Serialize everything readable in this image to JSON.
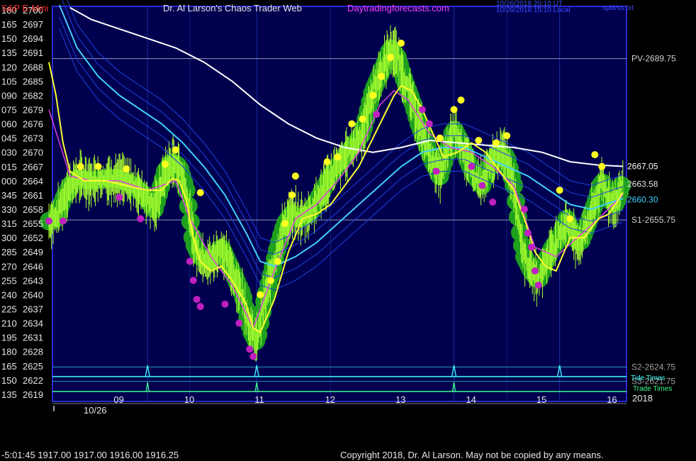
{
  "header": {
    "instrument": "S&P E-Mini",
    "site_title": "Dr. Al Larson's Chaos Trader Web",
    "site_url": "Daytradingforecasts.com",
    "timestamp_utc": "10/26/2018 20:10 UT",
    "timestamp_local": "10/26/2018 15:10 Local",
    "file_label": "split/ss.txt"
  },
  "footer": {
    "status": "-5:01:45  1917.00 1917.00 1916.00 1916.25",
    "copyright": "Copyright 2018, Dr. Al Larson. May not be copied by any means.",
    "year": "2018",
    "date_label": "10/26"
  },
  "colors": {
    "background": "#000000",
    "plot_bg": "#00004e",
    "frame": "#2a2ad0",
    "text": "#e6e6e6",
    "title_red": "#ff3030",
    "url_magenta": "#ff40ff",
    "price": "#a8ff30",
    "glow": "#1fa01f",
    "fast_ma": "#ffff30",
    "mid_ma": "#e040e0",
    "slow_ma": "#40d0ff",
    "slowest_ma": "#ffffff",
    "band": "#2040e0",
    "hi_dot": "#ffff20",
    "lo_dot": "#c020c0",
    "tide": "#40ffff",
    "trade": "#40ff90"
  },
  "chart_data": {
    "type": "line",
    "title": "S&P E-Mini",
    "y_axis": {
      "ylim": [
        2617.5,
        2700.75
      ],
      "price_ticks": [
        2700,
        2697,
        2694,
        2691,
        2688,
        2685,
        2682,
        2679,
        2676,
        2673,
        2670,
        2667,
        2664,
        2661,
        2658,
        2655,
        2652,
        2649,
        2646,
        2643,
        2640,
        2637,
        2634,
        2631,
        2628,
        2625,
        2622,
        2619
      ],
      "angle_ticks": [
        "180",
        "165",
        "150",
        "135",
        "120",
        "105",
        "090",
        "075",
        "060",
        "045",
        "030",
        "015",
        "000",
        "345",
        "330",
        "315",
        "300",
        "285",
        "270",
        "255",
        "240",
        "225",
        "210",
        "195",
        "180",
        "165",
        "150",
        "135"
      ]
    },
    "x_axis": {
      "hours": [
        "09",
        "10",
        "11",
        "12",
        "13",
        "14",
        "15",
        "16"
      ]
    },
    "levels": [
      {
        "name": "PV-2689.75",
        "value": 2689.75
      },
      {
        "name": "S1-2655.75",
        "value": 2655.75
      },
      {
        "name": "S2-2624.75",
        "value": 2624.75
      },
      {
        "name": "S3-2621.75",
        "value": 2621.75
      }
    ],
    "end_labels": [
      {
        "label": "2667.05",
        "value": 2667.05,
        "series": "slowest_ma"
      },
      {
        "label": "2663.58",
        "value": 2663.58,
        "series": "fast_ma"
      },
      {
        "label": "2660.30",
        "value": 2660.3,
        "series": "slow_ma"
      }
    ],
    "lines_legend": [
      "Tide Times",
      "Trade Times"
    ],
    "price_series": {
      "x": [
        8.0,
        8.1,
        8.2,
        8.3,
        8.4,
        8.6,
        8.8,
        9.0,
        9.2,
        9.35,
        9.5,
        9.65,
        9.75,
        9.85,
        9.95,
        10.05,
        10.15,
        10.3,
        10.45,
        10.6,
        10.75,
        10.82,
        10.88,
        10.95,
        11.05,
        11.15,
        11.25,
        11.35,
        11.45,
        11.55,
        11.7,
        11.85,
        12.0,
        12.15,
        12.3,
        12.45,
        12.6,
        12.75,
        12.85,
        12.95,
        13.05,
        13.15,
        13.25,
        13.35,
        13.45,
        13.55,
        13.65,
        13.75,
        13.85,
        13.95,
        14.05,
        14.15,
        14.25,
        14.4,
        14.5,
        14.6,
        14.7,
        14.75,
        14.85,
        14.95,
        15.05,
        15.15,
        15.25,
        15.35,
        15.45,
        15.55,
        15.65,
        15.75,
        15.85,
        15.95,
        16.05,
        16.15
      ],
      "values": [
        2655.5,
        2656,
        2660,
        2663,
        2664.5,
        2664,
        2664.5,
        2664.5,
        2663,
        2661,
        2658,
        2666,
        2668,
        2667,
        2662,
        2651,
        2648,
        2647,
        2650,
        2645,
        2640,
        2635,
        2632,
        2630,
        2638,
        2644,
        2650,
        2655,
        2657,
        2656,
        2657,
        2661,
        2665,
        2668,
        2671,
        2674,
        2683,
        2688,
        2692,
        2690,
        2685,
        2681,
        2676,
        2672,
        2668,
        2665,
        2670,
        2675,
        2672,
        2668,
        2665,
        2663,
        2667,
        2670,
        2669,
        2663,
        2652,
        2648,
        2645,
        2643,
        2647,
        2650,
        2652,
        2656,
        2652,
        2651,
        2655,
        2659,
        2664,
        2660,
        2659,
        2664
      ]
    },
    "highs": [
      {
        "x": 8.45,
        "v": 2667
      },
      {
        "x": 8.7,
        "v": 2667
      },
      {
        "x": 9.1,
        "v": 2666.5
      },
      {
        "x": 9.65,
        "v": 2667.5
      },
      {
        "x": 9.8,
        "v": 2670.5
      },
      {
        "x": 10.15,
        "v": 2661.5
      },
      {
        "x": 11.0,
        "v": 2640
      },
      {
        "x": 11.15,
        "v": 2643
      },
      {
        "x": 11.25,
        "v": 2647
      },
      {
        "x": 11.35,
        "v": 2655
      },
      {
        "x": 11.45,
        "v": 2661
      },
      {
        "x": 11.5,
        "v": 2665
      },
      {
        "x": 11.95,
        "v": 2668
      },
      {
        "x": 12.1,
        "v": 2669
      },
      {
        "x": 12.3,
        "v": 2676
      },
      {
        "x": 12.45,
        "v": 2677
      },
      {
        "x": 12.6,
        "v": 2682
      },
      {
        "x": 12.72,
        "v": 2686
      },
      {
        "x": 12.85,
        "v": 2690
      },
      {
        "x": 13.0,
        "v": 2693
      },
      {
        "x": 13.55,
        "v": 2673
      },
      {
        "x": 13.75,
        "v": 2679
      },
      {
        "x": 13.85,
        "v": 2681
      },
      {
        "x": 14.1,
        "v": 2672.5
      },
      {
        "x": 14.35,
        "v": 2672
      },
      {
        "x": 14.5,
        "v": 2673.5
      },
      {
        "x": 15.25,
        "v": 2662
      },
      {
        "x": 15.4,
        "v": 2656
      },
      {
        "x": 15.75,
        "v": 2669.5
      },
      {
        "x": 15.85,
        "v": 2667
      }
    ],
    "lows": [
      {
        "x": 8.0,
        "v": 2655.5
      },
      {
        "x": 8.2,
        "v": 2655.5
      },
      {
        "x": 9.0,
        "v": 2660.5
      },
      {
        "x": 9.3,
        "v": 2656
      },
      {
        "x": 10.0,
        "v": 2647
      },
      {
        "x": 10.05,
        "v": 2643
      },
      {
        "x": 10.1,
        "v": 2639
      },
      {
        "x": 10.15,
        "v": 2637.5
      },
      {
        "x": 10.5,
        "v": 2638
      },
      {
        "x": 10.7,
        "v": 2634
      },
      {
        "x": 10.85,
        "v": 2628.5
      },
      {
        "x": 10.9,
        "v": 2627
      },
      {
        "x": 12.65,
        "v": 2678
      },
      {
        "x": 13.3,
        "v": 2679
      },
      {
        "x": 13.4,
        "v": 2676
      },
      {
        "x": 13.5,
        "v": 2666
      },
      {
        "x": 14.0,
        "v": 2667
      },
      {
        "x": 14.15,
        "v": 2663
      },
      {
        "x": 14.3,
        "v": 2659.5
      },
      {
        "x": 14.75,
        "v": 2658
      },
      {
        "x": 14.8,
        "v": 2653
      },
      {
        "x": 14.85,
        "v": 2650
      },
      {
        "x": 14.9,
        "v": 2645
      },
      {
        "x": 14.95,
        "v": 2642
      }
    ],
    "fast_ma": {
      "x": [
        8.0,
        8.1,
        8.2,
        8.3,
        8.5,
        8.8,
        9.1,
        9.4,
        9.6,
        9.75,
        9.85,
        9.95,
        10.05,
        10.15,
        10.3,
        10.45,
        10.6,
        10.8,
        10.9,
        11.0,
        11.2,
        11.4,
        11.6,
        11.8,
        12.0,
        12.2,
        12.4,
        12.6,
        12.8,
        12.9,
        13.0,
        13.15,
        13.3,
        13.45,
        13.6,
        13.8,
        14.0,
        14.2,
        14.4,
        14.6,
        14.75,
        14.9,
        15.05,
        15.2,
        15.4,
        15.6,
        15.8,
        15.95,
        16.15
      ],
      "values": [
        2689,
        2682,
        2672,
        2666,
        2664,
        2664,
        2663,
        2662,
        2662,
        2664.5,
        2664,
        2660,
        2652,
        2647,
        2645,
        2646,
        2643,
        2638,
        2633,
        2632,
        2639,
        2649,
        2656,
        2657,
        2659,
        2663,
        2667,
        2673,
        2679,
        2682,
        2684,
        2683,
        2679,
        2674,
        2669,
        2670,
        2672,
        2670,
        2666,
        2662,
        2656,
        2649,
        2646,
        2645,
        2652,
        2652,
        2656,
        2657,
        2661.5
      ]
    },
    "mid_ma": {
      "x": [
        8.0,
        8.3,
        8.6,
        9.0,
        9.4,
        9.8,
        10.0,
        10.3,
        10.6,
        10.9,
        11.2,
        11.5,
        11.8,
        12.1,
        12.4,
        12.7,
        12.9,
        13.1,
        13.4,
        13.7,
        14.0,
        14.3,
        14.6,
        14.9,
        15.2,
        15.5,
        15.8,
        16.15
      ],
      "values": [
        2679,
        2665,
        2664,
        2664,
        2662,
        2664,
        2656,
        2648,
        2642,
        2633,
        2645,
        2656,
        2659,
        2664,
        2670,
        2680,
        2683,
        2681,
        2674,
        2671,
        2670,
        2667,
        2663,
        2650,
        2648,
        2652,
        2656,
        2661
      ]
    },
    "slow_ma": {
      "x": [
        8.15,
        8.4,
        8.7,
        9.0,
        9.3,
        9.6,
        9.9,
        10.2,
        10.5,
        10.8,
        11.0,
        11.2,
        11.5,
        11.8,
        12.1,
        12.4,
        12.7,
        13.0,
        13.3,
        13.6,
        13.9,
        14.2,
        14.5,
        14.8,
        15.1,
        15.4,
        15.7,
        16.15
      ],
      "values": [
        2701,
        2692,
        2686,
        2682,
        2679,
        2676,
        2672,
        2667,
        2661,
        2653,
        2647,
        2646,
        2648,
        2651,
        2655,
        2659,
        2663,
        2667,
        2670,
        2671,
        2671,
        2669,
        2667,
        2665,
        2662,
        2659,
        2658,
        2660.3
      ]
    },
    "slowest_ma": {
      "x": [
        8.3,
        8.6,
        9.0,
        9.4,
        9.8,
        10.2,
        10.6,
        11.0,
        11.4,
        11.8,
        12.2,
        12.6,
        13.0,
        13.4,
        13.8,
        14.2,
        14.6,
        15.0,
        15.4,
        15.8,
        16.15
      ],
      "values": [
        2700.5,
        2698,
        2696,
        2694,
        2692,
        2689,
        2685,
        2680,
        2676,
        2673,
        2671,
        2670,
        2671,
        2672.5,
        2672,
        2671.5,
        2671,
        2670,
        2668,
        2667.3,
        2667.05
      ]
    }
  }
}
